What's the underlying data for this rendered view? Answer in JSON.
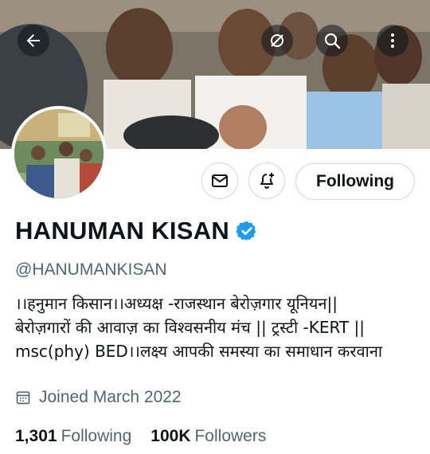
{
  "header": {
    "back_icon": "back-arrow-icon",
    "actions": [
      "grok-icon",
      "search-icon",
      "more-vertical-icon"
    ]
  },
  "profile": {
    "name": "HANUMAN KISAN",
    "handle": "@HANUMANKISAN",
    "verified_color": "#1d9bf0",
    "bio_lines": [
      "।।हनुमान किसान।।अध्यक्ष -राजस्थान बेरोज़गार यूनियन||",
      "बेरोज़गारों की आवाज़ का विश्वसनीय मंच || ट्रस्टी -KERT ||",
      "msc(phy) BED।।लक्ष्य आपकी समस्या का समाधान करवाना"
    ],
    "joined": "Joined March 2022"
  },
  "actions": {
    "following_label": "Following"
  },
  "stats": {
    "following_count": "1,301",
    "following_label": "Following",
    "followers_count": "100K",
    "followers_label": "Followers"
  }
}
